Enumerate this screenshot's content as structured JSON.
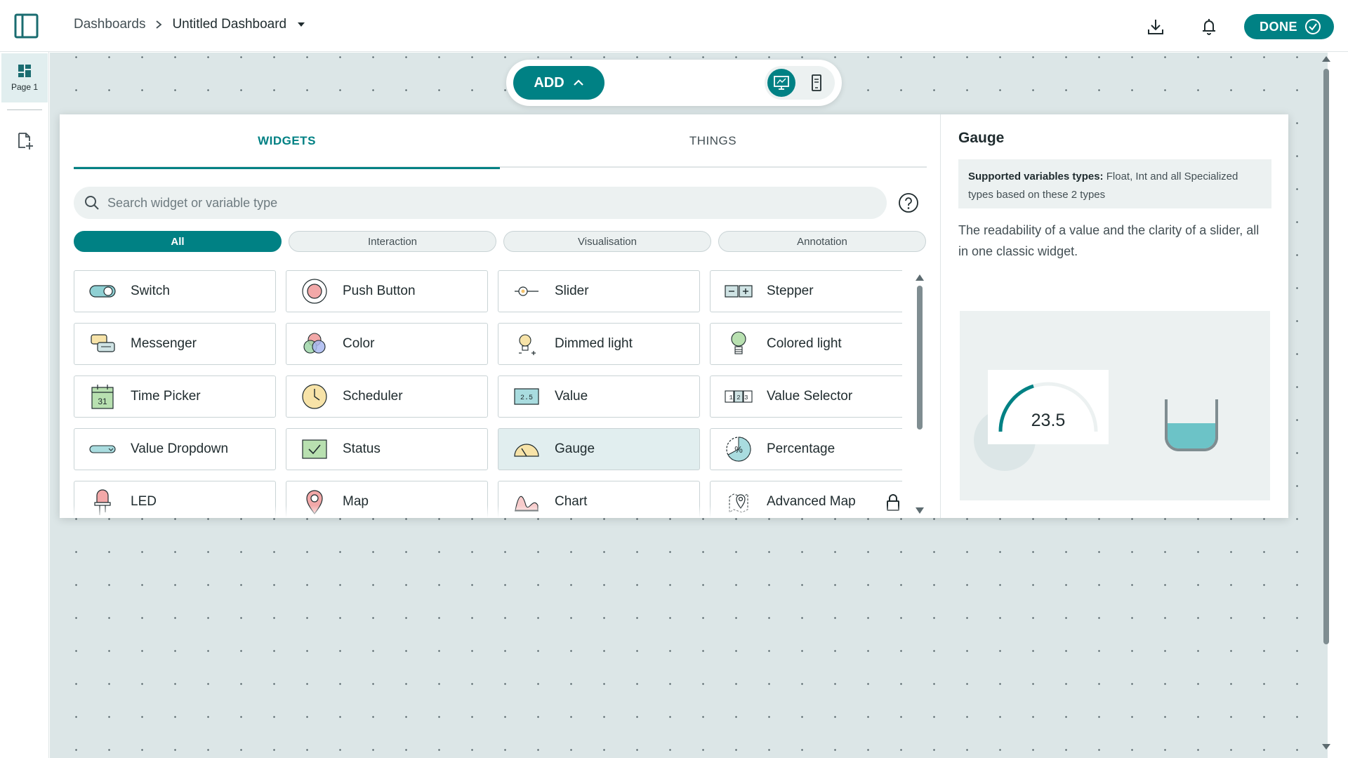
{
  "header": {
    "breadcrumb_root": "Dashboards",
    "dashboard_name": "Untitled Dashboard",
    "done_label": "DONE"
  },
  "rail": {
    "page_label": "Page 1"
  },
  "toolbar": {
    "add_label": "ADD"
  },
  "panel": {
    "tabs": [
      {
        "label": "WIDGETS",
        "active": true
      },
      {
        "label": "THINGS",
        "active": false
      }
    ],
    "search": {
      "placeholder": "Search widget or variable type",
      "value": ""
    },
    "filters": [
      {
        "label": "All",
        "active": true
      },
      {
        "label": "Interaction",
        "active": false
      },
      {
        "label": "Visualisation",
        "active": false
      },
      {
        "label": "Annotation",
        "active": false
      }
    ],
    "widgets": [
      {
        "label": "Switch",
        "icon": "switch-icon"
      },
      {
        "label": "Push Button",
        "icon": "push-button-icon"
      },
      {
        "label": "Slider",
        "icon": "slider-icon"
      },
      {
        "label": "Stepper",
        "icon": "stepper-icon"
      },
      {
        "label": "Messenger",
        "icon": "messenger-icon"
      },
      {
        "label": "Color",
        "icon": "color-icon"
      },
      {
        "label": "Dimmed light",
        "icon": "dimmed-light-icon"
      },
      {
        "label": "Colored light",
        "icon": "colored-light-icon"
      },
      {
        "label": "Time Picker",
        "icon": "time-picker-icon",
        "day": "31"
      },
      {
        "label": "Scheduler",
        "icon": "scheduler-icon"
      },
      {
        "label": "Value",
        "icon": "value-icon",
        "sample": "2.5"
      },
      {
        "label": "Value Selector",
        "icon": "value-selector-icon",
        "sample": "1 2 3"
      },
      {
        "label": "Value Dropdown",
        "icon": "value-dropdown-icon"
      },
      {
        "label": "Status",
        "icon": "status-icon"
      },
      {
        "label": "Gauge",
        "icon": "gauge-icon",
        "selected": true
      },
      {
        "label": "Percentage",
        "icon": "percentage-icon",
        "symbol": "%"
      },
      {
        "label": "LED",
        "icon": "led-icon"
      },
      {
        "label": "Map",
        "icon": "map-icon"
      },
      {
        "label": "Chart",
        "icon": "chart-icon"
      },
      {
        "label": "Advanced Map",
        "icon": "advanced-map-icon",
        "locked": true
      }
    ]
  },
  "detail": {
    "title": "Gauge",
    "supported_label": "Supported variables types:",
    "supported_text": "Float, Int and all Specialized types based on these 2 types",
    "description": "The readability of a value and the clarity of a slider, all in one classic widget.",
    "preview_value": "23.5"
  },
  "colors": {
    "accent": "#008184",
    "canvas": "#dce6e7",
    "chip": "#ecf1f1",
    "text": "#1f2b2e"
  }
}
